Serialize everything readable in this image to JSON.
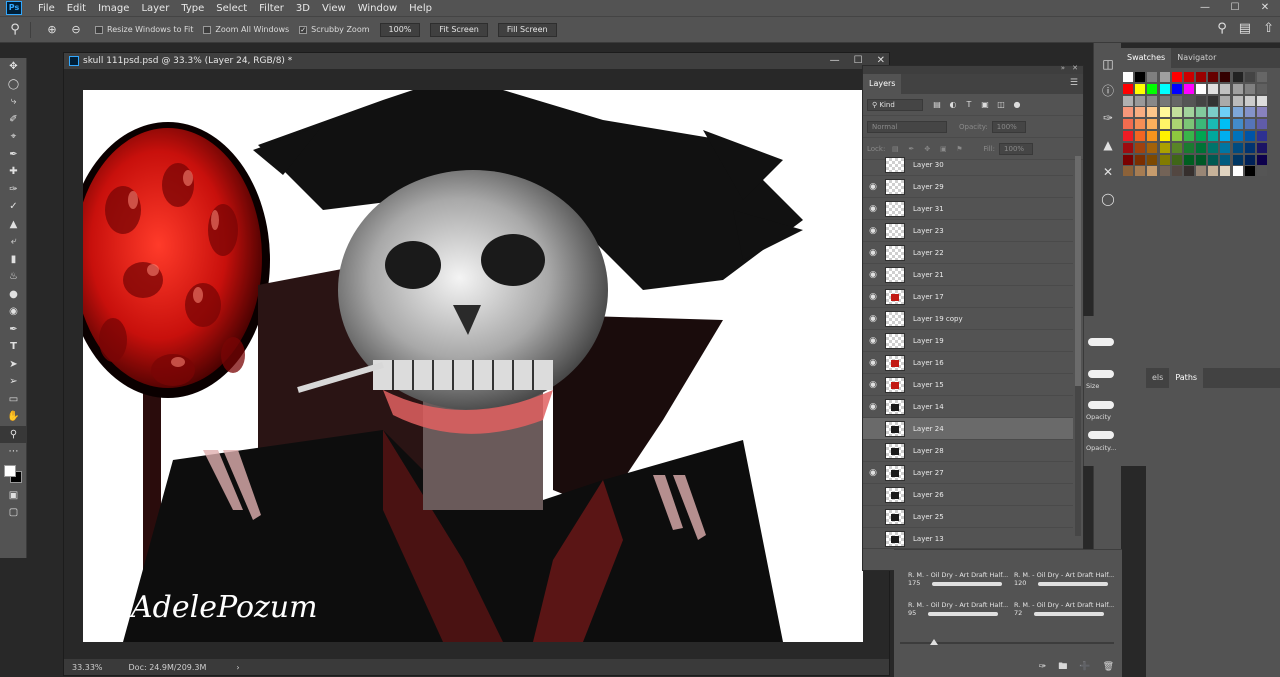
{
  "app": {
    "logo": "Ps"
  },
  "menu": [
    "File",
    "Edit",
    "Image",
    "Layer",
    "Type",
    "Select",
    "Filter",
    "3D",
    "View",
    "Window",
    "Help"
  ],
  "window_controls": {
    "minimize": "—",
    "maximize": "☐",
    "close": "✕"
  },
  "options_bar": {
    "resize_windows_label": "Resize Windows to Fit",
    "zoom_all_label": "Zoom All Windows",
    "scrubby_zoom_label": "Scrubby Zoom",
    "scrubby_checked": "✓",
    "zoom_value": "100%",
    "fit_screen": "Fit Screen",
    "fill_screen": "Fill Screen"
  },
  "document": {
    "title": "skull 111psd.psd @ 33.3% (Layer 24, RGB/8) *",
    "zoom": "33.33%",
    "doc_size": "Doc: 24.9M/209.3M",
    "signature": "AdelePozum",
    "status_arrow": "›"
  },
  "layers_panel": {
    "tab": "Layers",
    "filter_kind": "Kind",
    "blend_mode": "Normal",
    "opacity_label": "Opacity:",
    "opacity_value": "100%",
    "lock_label": "Lock:",
    "fill_label": "Fill:",
    "fill_value": "100%",
    "layers": [
      {
        "name": "Layer 30",
        "visible": false,
        "selected": false,
        "thumb": "none"
      },
      {
        "name": "Layer 29",
        "visible": true,
        "selected": false,
        "thumb": "none"
      },
      {
        "name": "Layer 31",
        "visible": true,
        "selected": false,
        "thumb": "none"
      },
      {
        "name": "Layer 23",
        "visible": true,
        "selected": false,
        "thumb": "none"
      },
      {
        "name": "Layer 22",
        "visible": true,
        "selected": false,
        "thumb": "none"
      },
      {
        "name": "Layer 21",
        "visible": true,
        "selected": false,
        "thumb": "none"
      },
      {
        "name": "Layer 17",
        "visible": true,
        "selected": false,
        "thumb": "red"
      },
      {
        "name": "Layer 19 copy",
        "visible": true,
        "selected": false,
        "thumb": "none"
      },
      {
        "name": "Layer 19",
        "visible": true,
        "selected": false,
        "thumb": "none"
      },
      {
        "name": "Layer 16",
        "visible": true,
        "selected": false,
        "thumb": "red"
      },
      {
        "name": "Layer 15",
        "visible": true,
        "selected": false,
        "thumb": "red"
      },
      {
        "name": "Layer 14",
        "visible": true,
        "selected": false,
        "thumb": "dark"
      },
      {
        "name": "Layer 24",
        "visible": false,
        "selected": true,
        "thumb": "dark"
      },
      {
        "name": "Layer 28",
        "visible": false,
        "selected": false,
        "thumb": "dark"
      },
      {
        "name": "Layer 27",
        "visible": true,
        "selected": false,
        "thumb": "dark"
      },
      {
        "name": "Layer 26",
        "visible": false,
        "selected": false,
        "thumb": "dark"
      },
      {
        "name": "Layer 25",
        "visible": false,
        "selected": false,
        "thumb": "dark"
      },
      {
        "name": "Layer 13",
        "visible": false,
        "selected": false,
        "thumb": "dark"
      }
    ],
    "footer_icons": [
      "link-icon",
      "fx-icon",
      "mask-icon",
      "adjustment-icon",
      "group-icon",
      "new-layer-icon",
      "trash-icon"
    ]
  },
  "swatches_panel": {
    "tab_active": "Swatches",
    "tab_other": "Navigator"
  },
  "paths_panel": {
    "tab_partial": "els",
    "tab_active": "Paths"
  },
  "brush_settings": {
    "labels": [
      "Size",
      "Opacity",
      "Opacity..."
    ]
  },
  "brush_presets": [
    {
      "name": "R. M. - Oil Dry - Art Draft Half...",
      "size": "175"
    },
    {
      "name": "R. M. - Oil Dry - Art Draft Half...",
      "size": "120"
    },
    {
      "name": "R. M. - Oil Dry - Art Draft Half...",
      "size": "95"
    },
    {
      "name": "R. M. - Oil Dry - Art Draft Half...",
      "size": "72"
    }
  ],
  "colors": {
    "panel": "#535353",
    "foreground": "#ffffff",
    "background": "#000000",
    "accent_red": "#e0201a"
  }
}
